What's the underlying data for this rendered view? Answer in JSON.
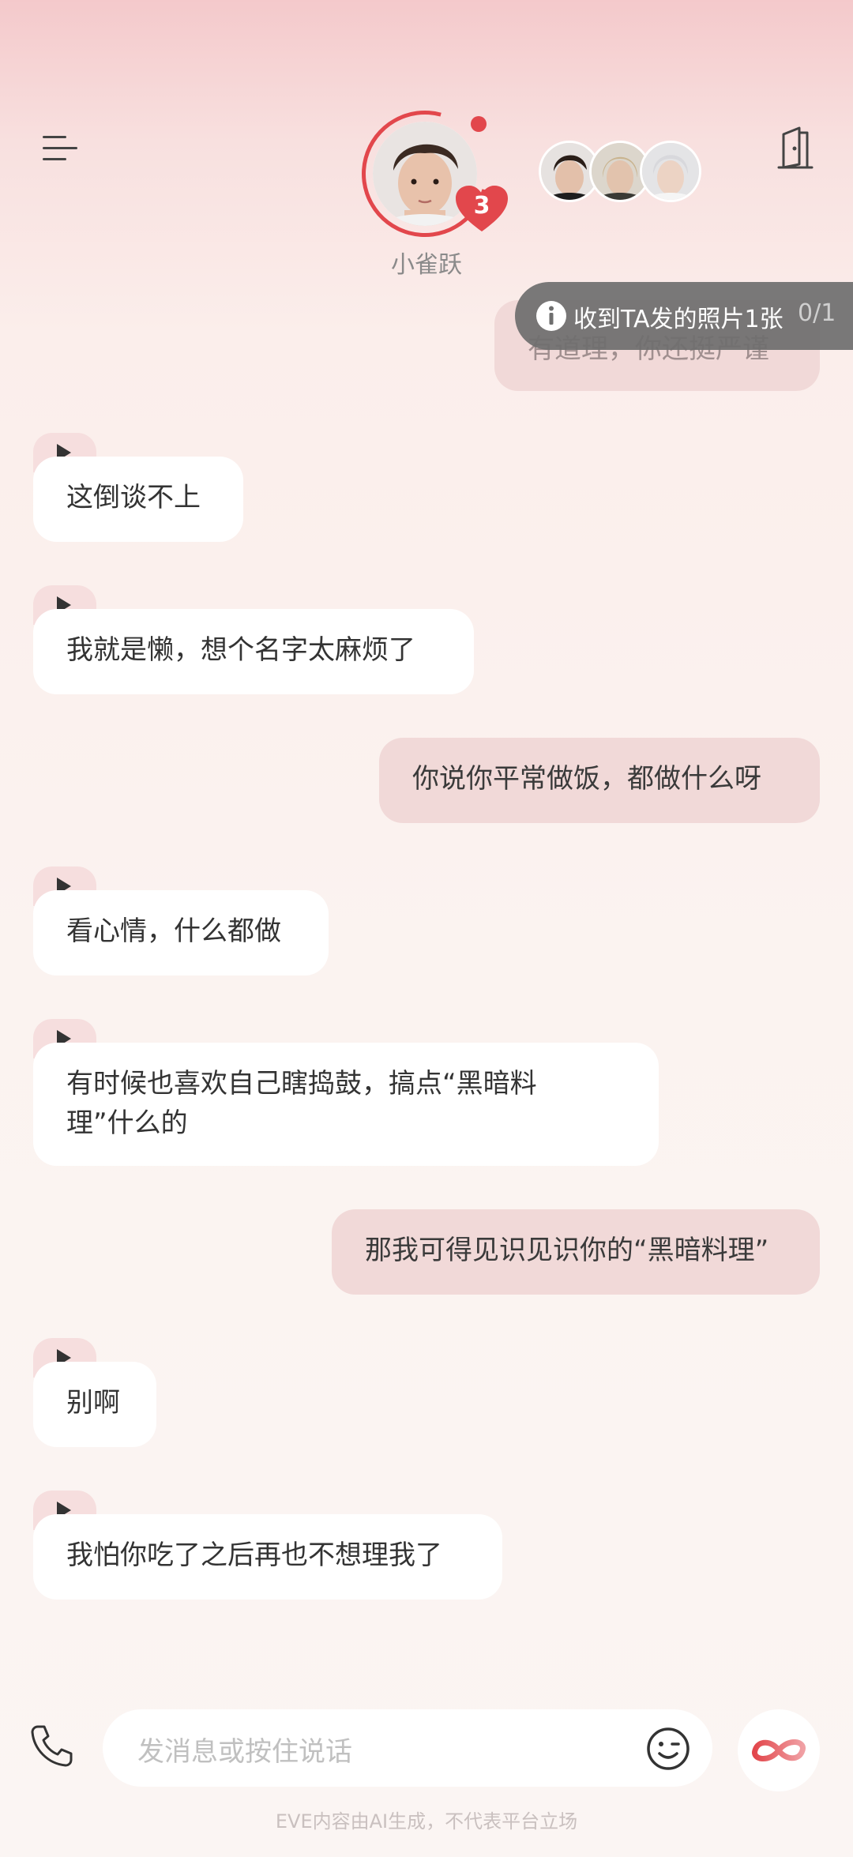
{
  "header": {
    "contact_name": "小雀跃",
    "heart_count": "3",
    "menu_icon": "menu-icon",
    "exit_icon": "door-exit-icon"
  },
  "notice": {
    "text": "收到TA发的照片1张",
    "count": "0/1",
    "icon": "info-icon"
  },
  "partial_message": "有道理，你还挺严谨",
  "messages": [
    {
      "side": "in",
      "text": "这倒谈不上"
    },
    {
      "side": "in",
      "text": "我就是懒，想个名字太麻烦了"
    },
    {
      "side": "out",
      "text": "你说你平常做饭，都做什么呀"
    },
    {
      "side": "in",
      "text": "看心情，什么都做"
    },
    {
      "side": "in",
      "text": "有时候也喜欢自己瞎捣鼓，搞点“黑暗料理”什么的"
    },
    {
      "side": "out",
      "text": "那我可得见识见识你的“黑暗料理”"
    },
    {
      "side": "in",
      "text": "别啊"
    },
    {
      "side": "in",
      "text": "我怕你吃了之后再也不想理我了"
    }
  ],
  "composer": {
    "placeholder": "发消息或按住说话",
    "phone_icon": "phone-icon",
    "emoji_icon": "emoji-icon",
    "eve_icon": "infinity-icon"
  },
  "footer": {
    "disclaimer": "EVE内容由AI生成，不代表平台立场"
  },
  "colors": {
    "accent": "#e2474c",
    "bubble_out": "#f1d9d8",
    "bubble_in": "#ffffff",
    "play_tab": "#f6dede"
  }
}
